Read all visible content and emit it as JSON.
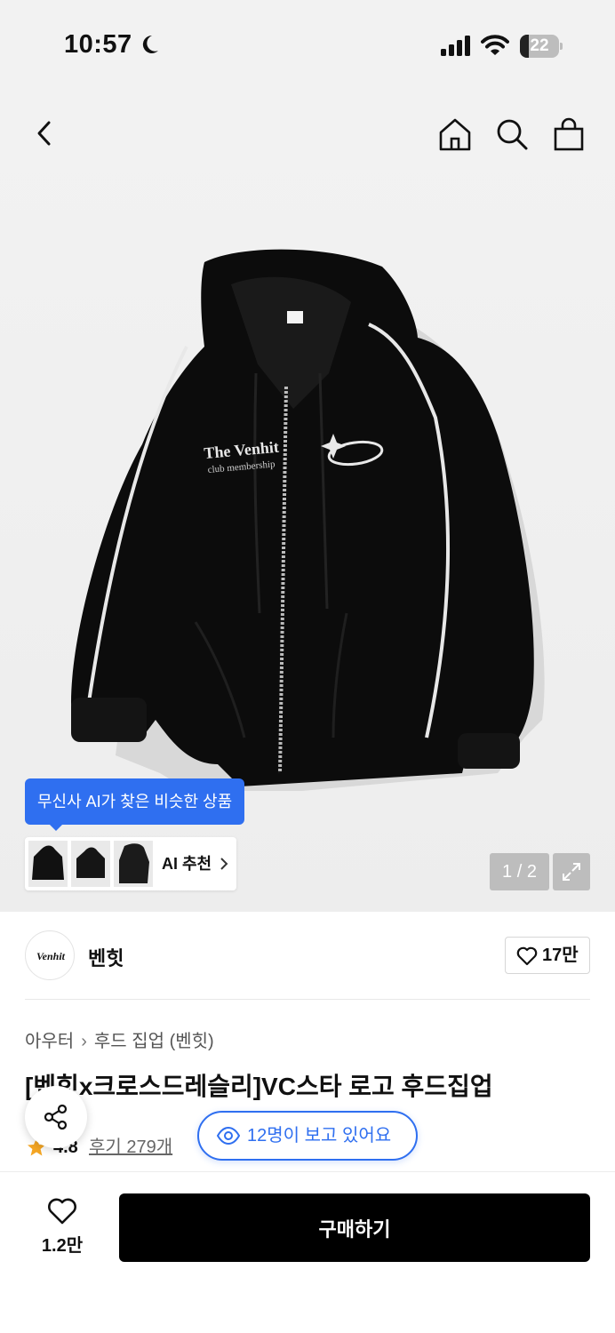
{
  "status_bar": {
    "time": "10:57",
    "battery": "22",
    "battery_level": 0.22
  },
  "nav": {
    "back": "back-icon",
    "home": "home-icon",
    "search": "search-icon",
    "bag": "shopping-bag-icon"
  },
  "gallery": {
    "ai_tooltip": "무신사 AI가 찾은 비슷한 상품",
    "ai_recommend_label": "AI 추천",
    "page_indicator": "1 / 2",
    "image_print_text": "The Venhit club membership"
  },
  "brand": {
    "logo_text": "Venhit",
    "name": "벤힛",
    "likes": "17만"
  },
  "breadcrumb": [
    "아우터",
    "후드 집업 (벤힛)"
  ],
  "product": {
    "title": "[벤힛x크로스드레슬리]VC스타 로고 후드집업",
    "rating": "4.8",
    "reviews": "후기 279개",
    "viewers": "12명이 보고 있어요"
  },
  "bottom": {
    "likes": "1.2만",
    "buy_label": "구매하기"
  },
  "colors": {
    "accent": "#2f6ff0",
    "star": "#f5a623",
    "buy_button": "#000000"
  }
}
